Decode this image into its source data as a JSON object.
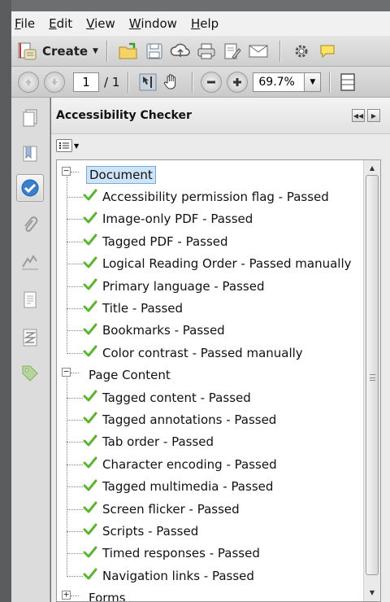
{
  "menu": [
    "File",
    "Edit",
    "View",
    "Window",
    "Help"
  ],
  "menu_underline": [
    "F",
    "E",
    "V",
    "W",
    "H"
  ],
  "toolbar": {
    "create_label": "Create",
    "icons": [
      "open-folder-icon",
      "save-icon",
      "cloud-upload-icon",
      "print-icon",
      "sign-icon",
      "email-icon",
      "settings-icon",
      "comment-icon"
    ]
  },
  "nav": {
    "current_page": "1",
    "page_total": "/ 1",
    "zoom": "69.7%"
  },
  "rail": [
    "pages-icon",
    "bookmarks-icon",
    "accessibility-icon",
    "attachments-icon",
    "signatures-icon",
    "content-icon",
    "order-icon",
    "tags-icon"
  ],
  "panel": {
    "title": "Accessibility Checker",
    "groups": [
      {
        "label": "Document",
        "expanded": true,
        "selected": true,
        "items": [
          "Accessibility permission flag - Passed",
          "Image-only PDF - Passed",
          "Tagged PDF - Passed",
          "Logical Reading Order - Passed manually",
          "Primary language - Passed",
          "Title - Passed",
          "Bookmarks - Passed",
          "Color contrast - Passed manually"
        ]
      },
      {
        "label": "Page Content",
        "expanded": true,
        "selected": false,
        "items": [
          "Tagged content - Passed",
          "Tagged annotations - Passed",
          "Tab order - Passed",
          "Character encoding - Passed",
          "Tagged multimedia - Passed",
          "Screen flicker - Passed",
          "Scripts - Passed",
          "Timed responses - Passed",
          "Navigation links - Passed"
        ]
      },
      {
        "label": "Forms",
        "expanded": false,
        "selected": false,
        "items": []
      }
    ]
  },
  "colors": {
    "check": "#5bb531",
    "selection": "#cde3f7",
    "accent_blue": "#3a7fc9"
  }
}
